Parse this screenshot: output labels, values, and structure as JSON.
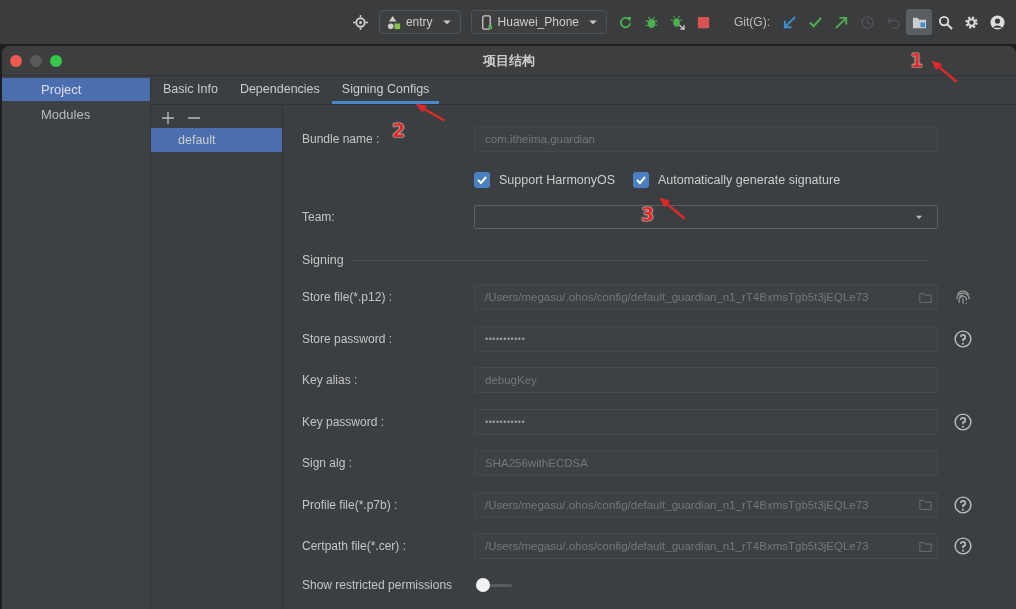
{
  "toolbar": {
    "target": "entry",
    "device": "Huawei_Phone",
    "git_label": "Git(G):",
    "left_buttons": [
      {
        "kind": "locate"
      }
    ],
    "run_buttons": [
      {
        "kind": "rerun"
      },
      {
        "kind": "debug"
      },
      {
        "kind": "attach"
      },
      {
        "kind": "stop"
      }
    ],
    "git_buttons": [
      {
        "kind": "update",
        "disabled": false
      },
      {
        "kind": "commit",
        "disabled": false
      },
      {
        "kind": "push",
        "disabled": false
      },
      {
        "kind": "history",
        "disabled": true
      },
      {
        "kind": "rollback",
        "disabled": true
      }
    ],
    "right_buttons": [
      {
        "kind": "structure",
        "selected": true
      },
      {
        "kind": "search",
        "selected": false
      },
      {
        "kind": "settings",
        "selected": false
      },
      {
        "kind": "account",
        "selected": false
      }
    ]
  },
  "window": {
    "title": "项目结构"
  },
  "sidebar": {
    "items": [
      {
        "label": "Project",
        "selected": true
      },
      {
        "label": "Modules",
        "selected": false
      }
    ]
  },
  "tabs": [
    {
      "label": "Basic Info",
      "selected": false
    },
    {
      "label": "Dependencies",
      "selected": false
    },
    {
      "label": "Signing Configs",
      "selected": true
    }
  ],
  "configs": [
    {
      "label": "default",
      "selected": true
    }
  ],
  "form": {
    "bundle_name": {
      "label": "Bundle name :",
      "value": "com.itheima.guardian"
    },
    "checkboxes": [
      {
        "label": "Support HarmonyOS",
        "checked": true
      },
      {
        "label": "Automatically generate signature",
        "checked": true
      }
    ],
    "team": {
      "label": "Team:"
    },
    "section": "Signing",
    "fields": [
      {
        "label": "Store file(*.p12) :",
        "value": "/Users/megasu/.ohos/config/default_guardian_n1_rT4BxmsTgb5t3jEQLe73",
        "kind": "file",
        "side_icon": {
          "kind": "fingerprint"
        }
      },
      {
        "label": "Store password :",
        "value": "•••••••••••",
        "kind": "password",
        "side_icon": {
          "kind": "help"
        }
      },
      {
        "label": "Key alias :",
        "value": "debugKey",
        "kind": "text"
      },
      {
        "label": "Key password :",
        "value": "•••••••••••",
        "kind": "password",
        "side_icon": {
          "kind": "help"
        }
      },
      {
        "label": "Sign alg :",
        "value": "SHA256withECDSA",
        "kind": "text"
      },
      {
        "label": "Profile file(*.p7b) :",
        "value": "/Users/megasu/.ohos/config/default_guardian_n1_rT4BxmsTgb5t3jEQLe73",
        "kind": "file",
        "side_icon": {
          "kind": "help"
        }
      },
      {
        "label": "Certpath file(*.cer) :",
        "value": "/Users/megasu/.ohos/config/default_guardian_n1_rT4BxmsTgb5t3jEQLe73",
        "kind": "file",
        "side_icon": {
          "kind": "help"
        }
      }
    ],
    "toggle": {
      "label": "Show restricted permissions",
      "on": false
    }
  },
  "annotations": [
    {
      "number": "1"
    },
    {
      "number": "2"
    },
    {
      "number": "3"
    }
  ]
}
